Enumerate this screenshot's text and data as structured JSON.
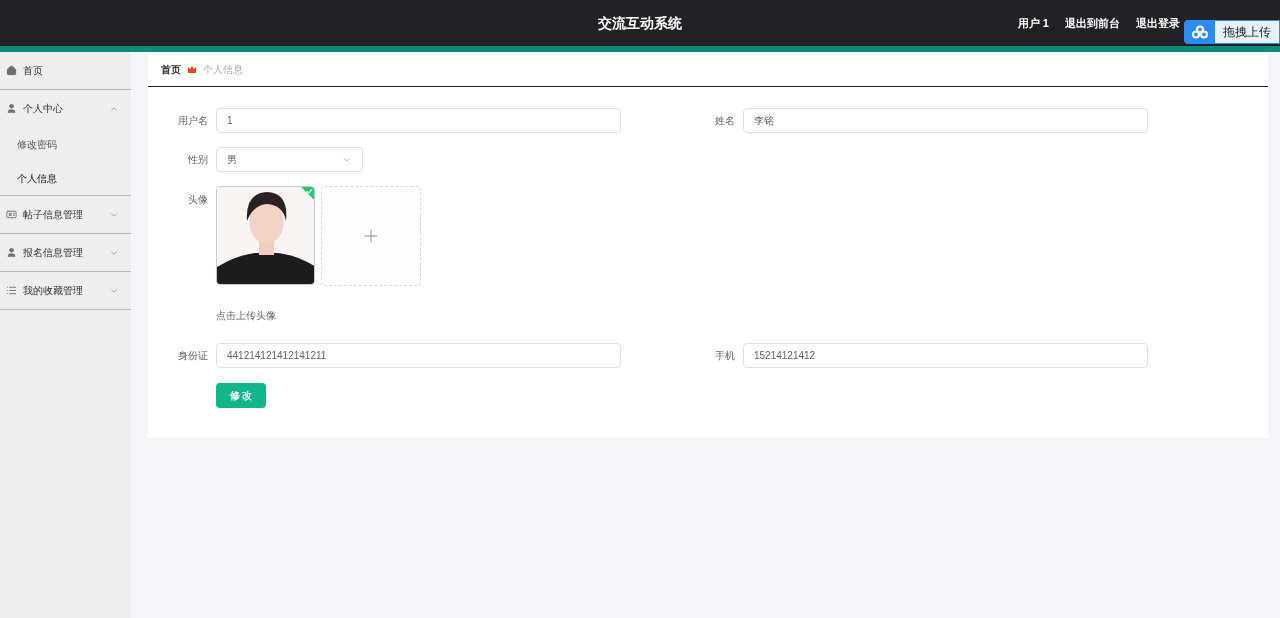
{
  "header": {
    "title": "交流互动系统",
    "links": [
      "用户 1",
      "退出到前台",
      "退出登录"
    ]
  },
  "upload_widget": {
    "label": "拖拽上传"
  },
  "sidebar": {
    "items": [
      {
        "label": "首页"
      },
      {
        "label": "个人中心",
        "expanded": true,
        "children": [
          {
            "label": "修改密码",
            "selected": false
          },
          {
            "label": "个人信息",
            "selected": true
          }
        ]
      },
      {
        "label": "帖子信息管理",
        "expanded": false
      },
      {
        "label": "报名信息管理",
        "expanded": false
      },
      {
        "label": "我的收藏管理",
        "expanded": false
      }
    ]
  },
  "breadcrumb": [
    "首页",
    "个人信息"
  ],
  "form": {
    "username": {
      "label": "用户名",
      "value": "1"
    },
    "name": {
      "label": "姓名",
      "value": "李铭"
    },
    "gender": {
      "label": "性别",
      "value": "男"
    },
    "avatar": {
      "label": "头像",
      "uploaded": true,
      "hint": "点击上传头像"
    },
    "id_card": {
      "label": "身份证",
      "value": "441214121412141211"
    },
    "phone": {
      "label": "手机",
      "value": "15214121412"
    },
    "submit": "修 改"
  }
}
